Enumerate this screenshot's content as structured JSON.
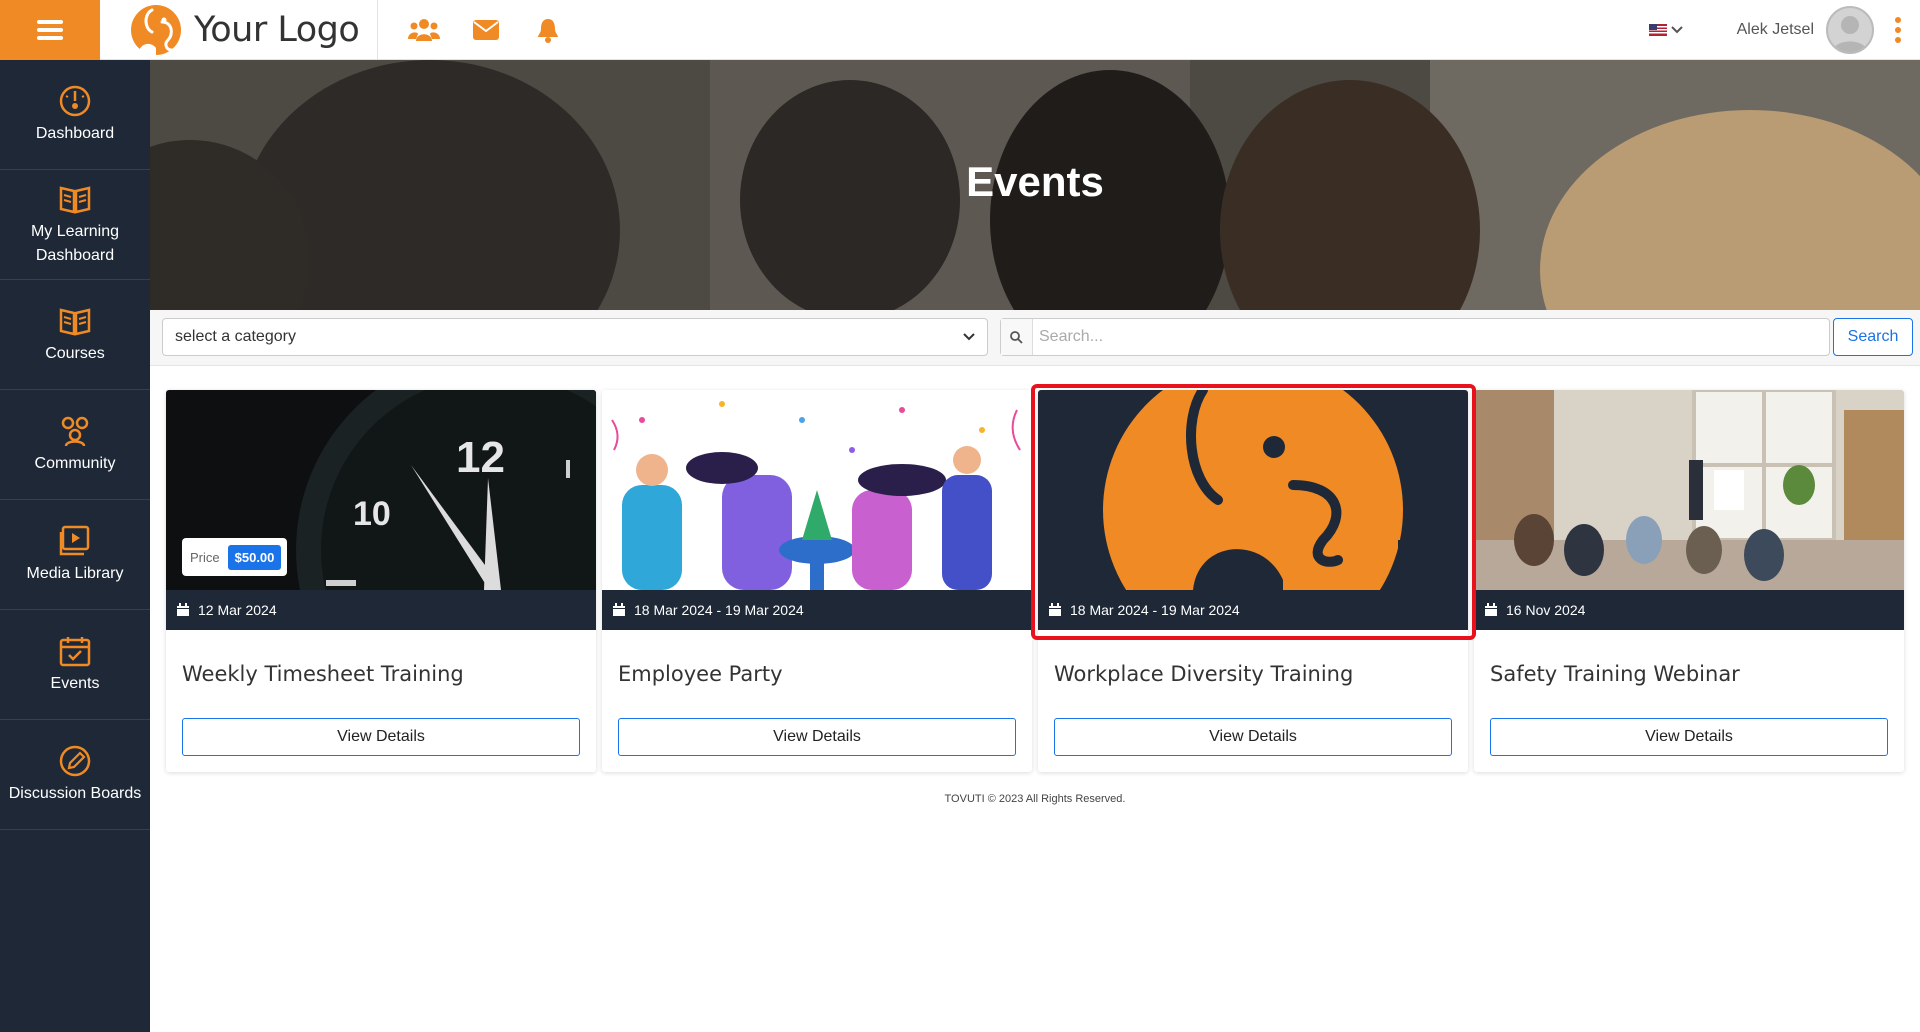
{
  "topbar": {
    "logo_text": "Your Logo",
    "user_name": "Alek Jetsel",
    "accent_color": "#f08a24",
    "icons": [
      "users-icon",
      "envelope-icon",
      "bell-icon"
    ]
  },
  "sidebar": {
    "items": [
      {
        "label": "Dashboard",
        "icon": "dashboard-icon"
      },
      {
        "label": "My Learning Dashboard",
        "icon": "book-open-icon"
      },
      {
        "label": "Courses",
        "icon": "book-icon"
      },
      {
        "label": "Community",
        "icon": "community-icon"
      },
      {
        "label": "Media Library",
        "icon": "media-icon"
      },
      {
        "label": "Events",
        "icon": "calendar-icon"
      },
      {
        "label": "Discussion Boards",
        "icon": "edit-icon"
      }
    ]
  },
  "hero": {
    "title": "Events"
  },
  "filters": {
    "category_value": "select a category",
    "search_placeholder": "Search...",
    "search_button": "Search"
  },
  "cards": [
    {
      "title": "Weekly Timesheet Training",
      "date": "12 Mar 2024",
      "button": "View Details",
      "price_label": "Price",
      "price": "$50.00"
    },
    {
      "title": "Employee Party",
      "date": "18 Mar 2024 - 19 Mar 2024",
      "button": "View Details"
    },
    {
      "title": "Workplace Diversity Training",
      "date": "18 Mar 2024 - 19 Mar 2024",
      "button": "View Details"
    },
    {
      "title": "Safety Training Webinar",
      "date": "16 Nov 2024",
      "button": "View Details"
    }
  ],
  "footer": {
    "text": "TOVUTI © 2023 All Rights Reserved."
  }
}
